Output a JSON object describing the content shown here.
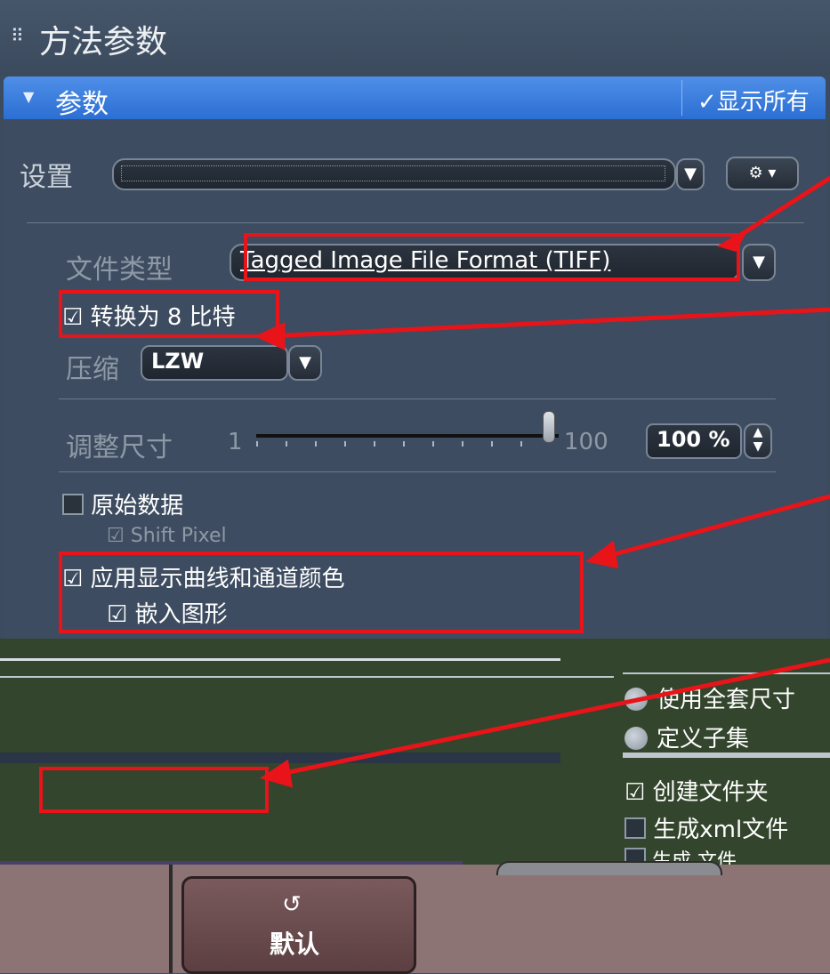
{
  "header": {
    "grip_icon": "grip-icon",
    "title": "方法参数"
  },
  "params_bar": {
    "title": "参数",
    "show_all": "✓显示所有"
  },
  "settings": {
    "label": "设置",
    "value": ""
  },
  "file_type": {
    "label": "文件类型",
    "value": "Tagged Image File Format (TIFF)"
  },
  "convert8": {
    "label": "转换为 8 比特",
    "checked": true
  },
  "compress": {
    "label": "压缩",
    "value": "LZW"
  },
  "resize": {
    "label": "调整尺寸",
    "label_truncated": "调整尺寸",
    "min": "1",
    "max": "100",
    "value": "100 %",
    "level": 100
  },
  "raw_data": {
    "label": "原始数据",
    "checked": false
  },
  "shift_pixel": {
    "label": "Shift Pixel",
    "checked": true
  },
  "apply_curve": {
    "label": "应用显示曲线和通道颜色",
    "checked": true
  },
  "embed_graphics": {
    "label": "嵌入图形",
    "checked": true
  },
  "lower": {
    "use_full_size": "使用全套尺寸",
    "define_subset": "定义子集",
    "create_folder": "创建文件夹",
    "generate_xml": "生成xml文件",
    "generate_info": "生成 文件"
  },
  "footer": {
    "default_label": "默认"
  },
  "colors": {
    "accent": "#2c6fd3",
    "panel": "#3d4c60",
    "annotation": "#e8141a",
    "footer": "#8c7474"
  }
}
